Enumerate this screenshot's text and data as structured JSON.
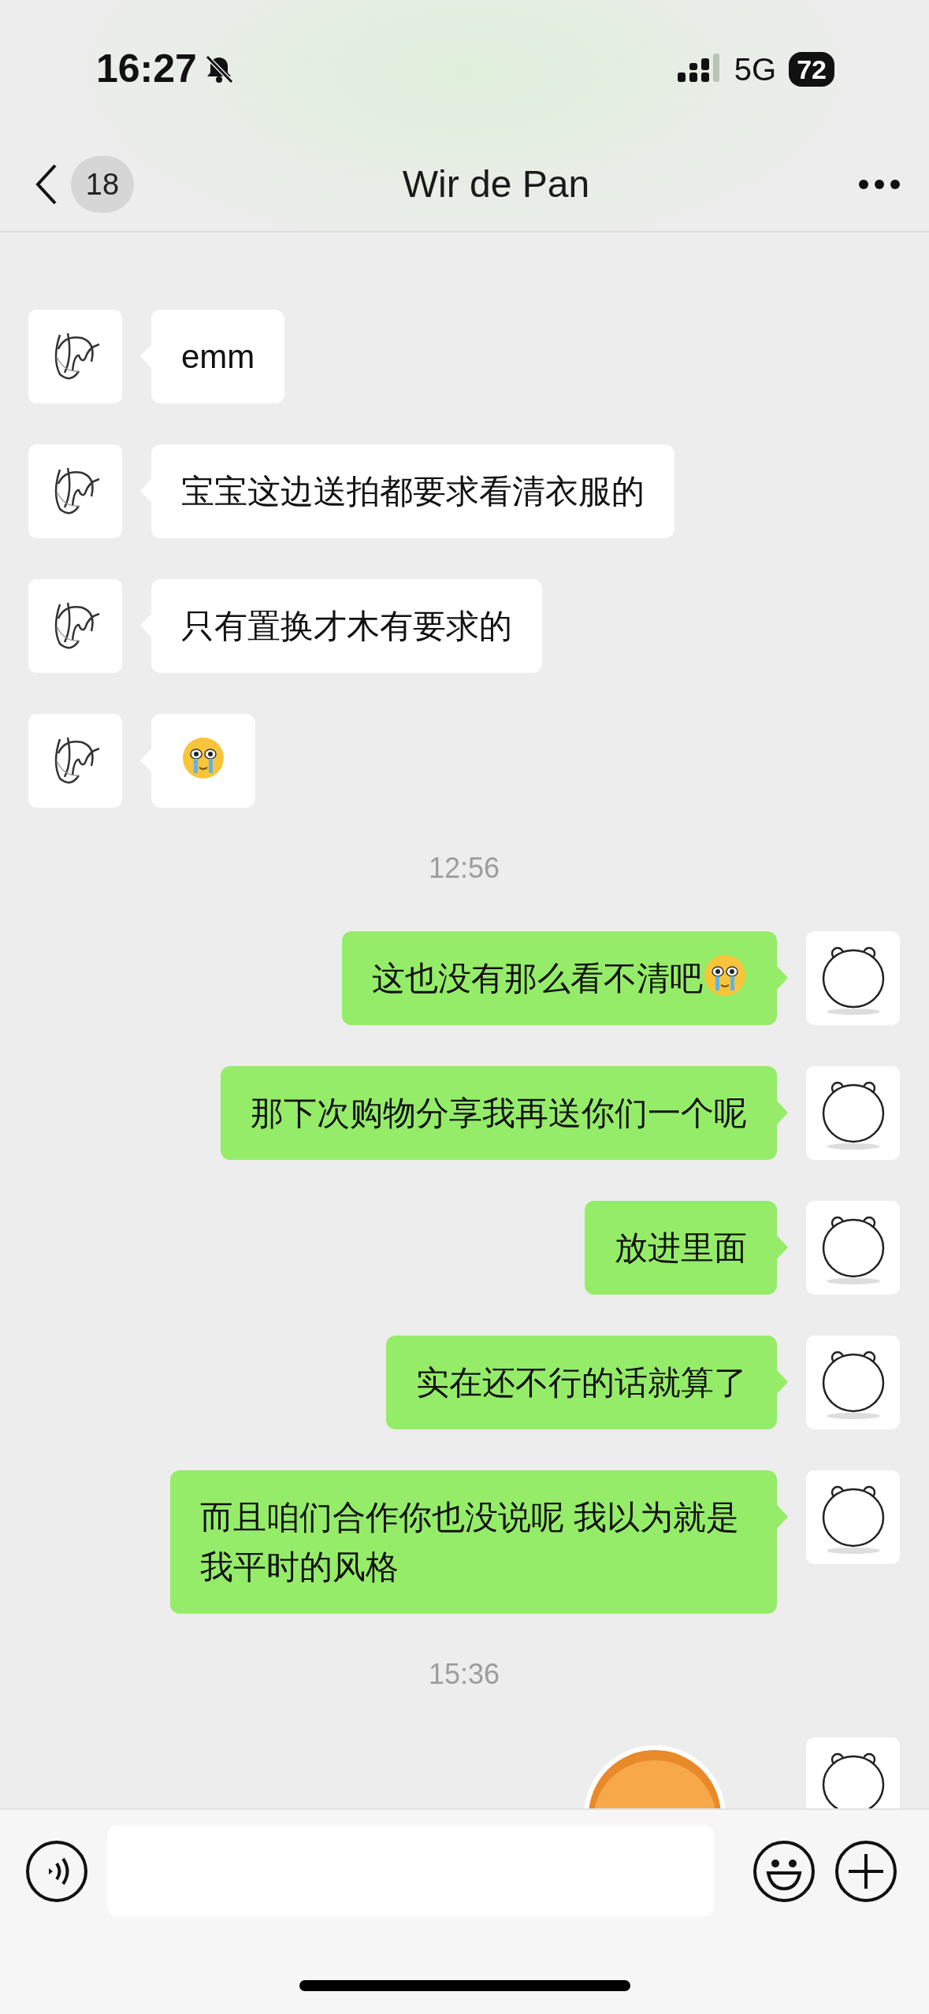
{
  "status_bar": {
    "time": "16:27",
    "network": "5G",
    "battery": "72"
  },
  "nav": {
    "unread": "18",
    "title": "Wir de Pan"
  },
  "messages": [
    {
      "kind": "received_text",
      "text": "emm"
    },
    {
      "kind": "received_text",
      "text": "宝宝这边送拍都要求看清衣服的"
    },
    {
      "kind": "received_text",
      "text": "只有置换才木有要求的"
    },
    {
      "kind": "received_emoji"
    },
    {
      "kind": "time",
      "text": "12:56"
    },
    {
      "kind": "sent_text",
      "text": "这也没有那么看不清吧",
      "emoji_after": true
    },
    {
      "kind": "sent_text",
      "text": "那下次购物分享我再送你们一个呢"
    },
    {
      "kind": "sent_text",
      "text": "放进里面"
    },
    {
      "kind": "sent_text",
      "text": "实在还不行的话就算了"
    },
    {
      "kind": "sent_text",
      "text": "而且咱们合作你也没说呢 我以为就是我平时的风格"
    },
    {
      "kind": "time",
      "text": "15:36"
    },
    {
      "kind": "sent_sticker"
    }
  ]
}
